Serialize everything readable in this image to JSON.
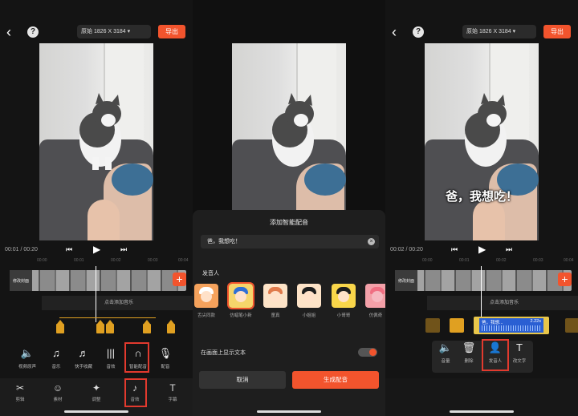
{
  "editor": {
    "ratio_label": "原始",
    "resolution": "1826 X 3184",
    "export_label": "导出",
    "help_label": "?",
    "back_glyph": "‹"
  },
  "panel1": {
    "timecode": "00:01 / 00:20",
    "cover_label": "修改封面",
    "add_music": "点击添加音乐",
    "tools": [
      {
        "icon": "volume-icon",
        "glyph": "🔈",
        "label": "视频原声"
      },
      {
        "icon": "music-note-icon",
        "glyph": "♫",
        "label": "音乐"
      },
      {
        "icon": "quick-record-icon",
        "glyph": "♬",
        "label": "快手收藏"
      },
      {
        "icon": "sound-effect-icon",
        "glyph": "|||",
        "label": "音效"
      },
      {
        "icon": "smart-voice-icon",
        "glyph": "∩",
        "label": "智能配音"
      },
      {
        "icon": "microphone-icon",
        "glyph": "🎙",
        "label": "配音"
      }
    ],
    "tabs": [
      {
        "icon": "scissors-icon",
        "glyph": "✂",
        "label": "剪辑"
      },
      {
        "icon": "sticker-icon",
        "glyph": "☺",
        "label": "素材"
      },
      {
        "icon": "adjust-icon",
        "glyph": "✦",
        "label": "调整"
      },
      {
        "icon": "audio-icon",
        "glyph": "♪",
        "label": "音效"
      },
      {
        "icon": "text-icon",
        "glyph": "T",
        "label": "字幕"
      }
    ]
  },
  "panel2": {
    "sheet_title": "添加智能配音",
    "input_text": "爸，我想吃！",
    "speaker_label": "发音人",
    "speakers": [
      {
        "name": "舌尖同款",
        "bg": "#f5a25c",
        "hair": "#ffffff"
      },
      {
        "name": "仿蜡笔小新",
        "bg": "#f6d56b",
        "hair": "#2f6fd6"
      },
      {
        "name": "童真",
        "bg": "#fde3c7",
        "hair": "#e07a4b"
      },
      {
        "name": "小姐姐",
        "bg": "#fde3c7",
        "hair": "#1d1d1d"
      },
      {
        "name": "小哥哥",
        "bg": "#f9d64a",
        "hair": "#1d1d1d"
      },
      {
        "name": "仿佩奇",
        "bg": "#f3a0a8",
        "hair": "#f06f82"
      }
    ],
    "show_text_label": "在画面上显示文本",
    "cancel_label": "取消",
    "generate_label": "生成配音"
  },
  "panel3": {
    "timecode": "00:02 / 00:20",
    "subtitle": "爸，我想吃！",
    "clip_title": "爸，我想...",
    "clip_speed": "2.22s",
    "add_music": "点击添加音乐",
    "actions": [
      {
        "icon": "volume-icon",
        "glyph": "🔈",
        "label": "音量"
      },
      {
        "icon": "trash-icon",
        "glyph": "🗑",
        "label": "删除"
      },
      {
        "icon": "speaker-person-icon",
        "glyph": "👤",
        "label": "发音人"
      },
      {
        "icon": "edit-text-icon",
        "glyph": "T",
        "label": "改文字"
      }
    ]
  },
  "ruler_ticks": [
    "00:00",
    "00:01",
    "00:02",
    "00:03",
    "00:04"
  ],
  "colors": {
    "accent": "#f2542d",
    "highlight": "#e23a2e",
    "marker": "#e0a021"
  }
}
